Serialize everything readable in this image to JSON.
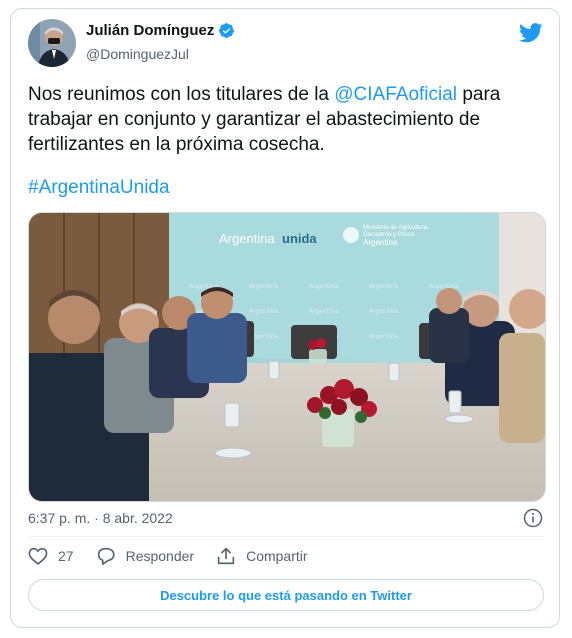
{
  "author": {
    "name": "Julián Domínguez",
    "handle": "@DominguezJul"
  },
  "tweet": {
    "text_part1": "Nos reunimos con los titulares de la ",
    "mention": "@CIAFAoficial",
    "text_part2": " para trabajar en conjunto y garantizar el abastecimiento de fertilizantes en la próxima cosecha.",
    "hashtag": "#ArgentinaUnida"
  },
  "photo": {
    "banner_text_brand": "Argentina",
    "banner_text_unida": "unida",
    "ministry_line1": "Ministerio de Agricultura,",
    "ministry_line2": "Ganadería y Pesca",
    "ministry_line3": "Argentina"
  },
  "meta": {
    "timestamp": "6:37 p. m. · 8 abr. 2022"
  },
  "actions": {
    "like_count": "27",
    "reply_label": "Responder",
    "share_label": "Compartir"
  },
  "cta": {
    "label": "Descubre lo que está pasando en Twitter"
  },
  "colors": {
    "accent": "#1d9bf0",
    "secondary_text": "#536471",
    "border": "#cfd9de"
  }
}
